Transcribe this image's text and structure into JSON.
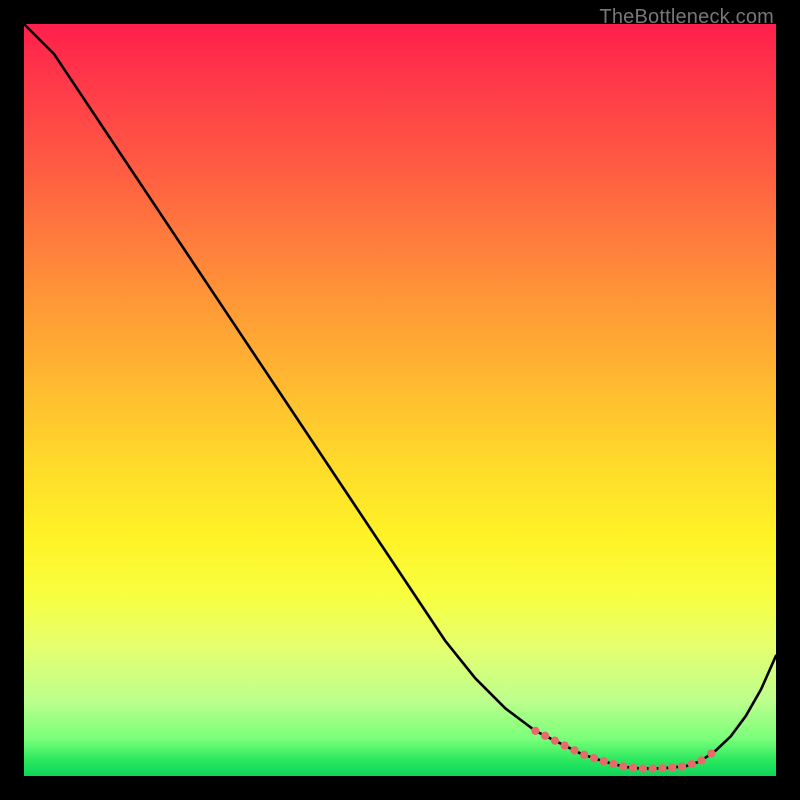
{
  "watermark": "TheBottleneck.com",
  "colors": {
    "curve": "#000000",
    "dots": "#e76b6b",
    "gradient_top": "#ff1f4b",
    "gradient_mid": "#ffe028",
    "gradient_bottom": "#10d45a",
    "page_bg": "#000000"
  },
  "chart_data": {
    "type": "line",
    "title": "",
    "xlabel": "",
    "ylabel": "",
    "xlim": [
      0,
      100
    ],
    "ylim": [
      0,
      100
    ],
    "x": [
      0,
      4,
      8,
      12,
      16,
      20,
      24,
      28,
      32,
      36,
      40,
      44,
      48,
      52,
      56,
      60,
      64,
      68,
      70,
      72,
      74,
      76,
      78,
      80,
      82,
      84,
      86,
      88,
      90,
      92,
      94,
      96,
      98,
      100
    ],
    "y": [
      100,
      96,
      90,
      84,
      78,
      72,
      66,
      60,
      54,
      48,
      42,
      36,
      30,
      24,
      18,
      13,
      9,
      6,
      5,
      4,
      3,
      2.3,
      1.7,
      1.2,
      1,
      1,
      1.1,
      1.3,
      2,
      3.4,
      5.3,
      8,
      11.5,
      16
    ],
    "valley_emphasis": {
      "x_start": 68,
      "x_end": 92,
      "style": "red-dots"
    },
    "background": "vertical-gradient red→yellow→green (low y = green = good)",
    "description": "Bottleneck-style curve: steep near-linear descent from top-left, flattening into a shallow valley around x≈80–88 near y≈1, then rising again toward the right edge."
  }
}
